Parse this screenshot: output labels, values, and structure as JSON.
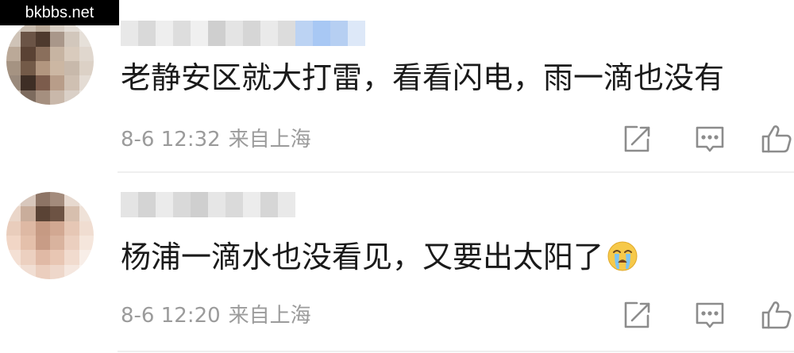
{
  "watermark": "bkbbs.net",
  "colors": {
    "text_primary": "#1a1a1a",
    "text_meta": "#9b9b9b",
    "icon": "#8c8c8c",
    "divider": "#efefef",
    "username_blur_accent": "#a8c8f4"
  },
  "comments": [
    {
      "text": "老静安区就大打雷，看看闪电，雨一滴也没有",
      "timestamp": "8-6 12:32",
      "location": "来自上海",
      "icons": [
        "share-icon",
        "reply-icon",
        "like-icon"
      ]
    },
    {
      "text": "杨浦一滴水也没看见，又要出太阳了",
      "emoji": "crying-face-emoji",
      "timestamp": "8-6 12:20",
      "location": "来自上海",
      "icons": [
        "share-icon",
        "reply-icon",
        "like-icon"
      ]
    }
  ]
}
